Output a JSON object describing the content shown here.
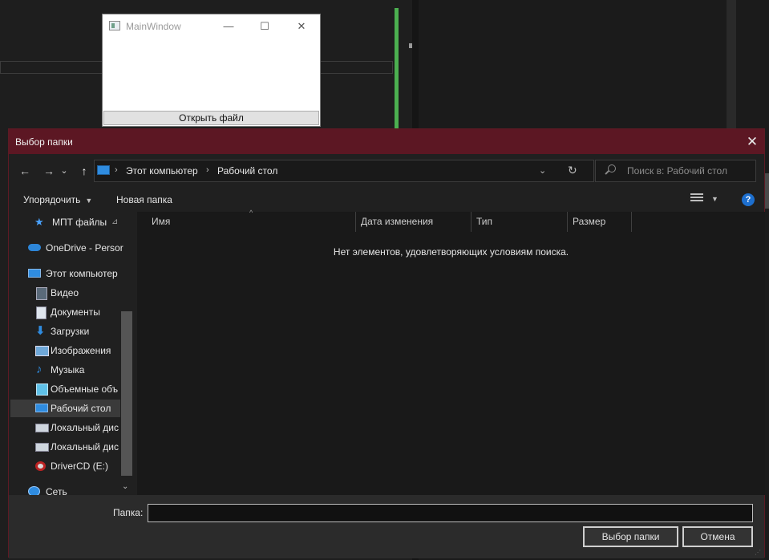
{
  "main_window": {
    "title": "MainWindow",
    "controls": {
      "minimize": "—",
      "maximize": "☐",
      "close": "✕"
    },
    "open_button": "Открыть файл"
  },
  "dialog": {
    "title": "Выбор папки",
    "close_glyph": "✕",
    "nav": {
      "back": "←",
      "forward": "→",
      "recent": "⌄",
      "up": "↑"
    },
    "address": {
      "crumbs": [
        "Этот компьютер",
        "Рабочий стол"
      ],
      "separator": "›",
      "dropdown": "⌄",
      "refresh": "↻"
    },
    "search": {
      "placeholder": "Поиск в: Рабочий стол"
    },
    "toolbar": {
      "organize": "Упорядочить",
      "new_folder": "Новая папка",
      "caret": "▼",
      "help": "?"
    },
    "nav_pane": {
      "items": [
        {
          "label": "МПТ файлы",
          "icon": "star-icon",
          "pinned": true
        },
        {
          "label": "OneDrive - Persor",
          "icon": "cloud-icon"
        },
        {
          "label": "Этот компьютер",
          "icon": "computer-icon"
        },
        {
          "label": "Видео",
          "icon": "video-icon"
        },
        {
          "label": "Документы",
          "icon": "document-icon"
        },
        {
          "label": "Загрузки",
          "icon": "download-icon"
        },
        {
          "label": "Изображения",
          "icon": "image-icon"
        },
        {
          "label": "Музыка",
          "icon": "music-icon"
        },
        {
          "label": "Объемные объ",
          "icon": "cube-icon"
        },
        {
          "label": "Рабочий стол",
          "icon": "desktop-icon",
          "selected": true
        },
        {
          "label": "Локальный дис",
          "icon": "drive-icon"
        },
        {
          "label": "Локальный дис",
          "icon": "drive-icon"
        },
        {
          "label": "DriverCD (E:)",
          "icon": "cd-drive-icon"
        },
        {
          "label": "Сеть",
          "icon": "network-icon"
        }
      ],
      "pin_glyph": "📌",
      "scroll_down": "⌄"
    },
    "columns": [
      "Имя",
      "Дата изменения",
      "Тип",
      "Размер"
    ],
    "sort_caret": "^",
    "empty_message": "Нет элементов, удовлетворяющих условиям поиска.",
    "folder_label": "Папка:",
    "folder_value": "",
    "buttons": {
      "ok": "Выбор папки",
      "cancel": "Отмена"
    },
    "colors": {
      "titlebar": "#5c1723",
      "accent_blue": "#1d6fcf",
      "background": "#202020"
    }
  }
}
